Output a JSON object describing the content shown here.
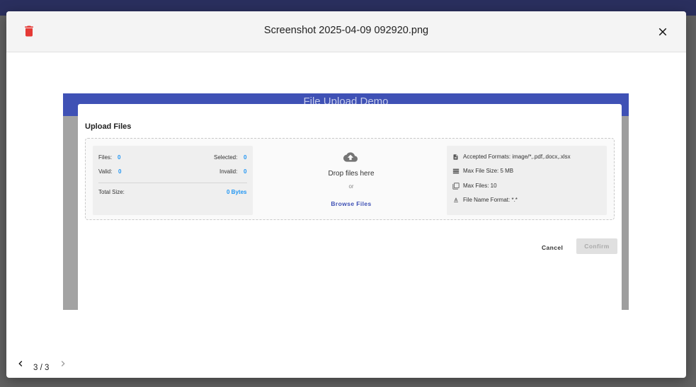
{
  "colors": {
    "trash": "#e53935",
    "accent": "#2196f3",
    "appbar": "#3f51b5"
  },
  "viewer": {
    "title": "Screenshot 2025-04-09 092920.png",
    "page_indicator": "3 / 3",
    "icons": {
      "delete": "trash-icon",
      "close": "close-icon",
      "prev": "chevron-left-icon",
      "next": "chevron-right-icon"
    }
  },
  "preview": {
    "app_title": "File Upload Demo",
    "dialog_title": "Upload Files",
    "stats": {
      "files_label": "Files:",
      "files_value": "0",
      "selected_label": "Selected:",
      "selected_value": "0",
      "valid_label": "Valid:",
      "valid_value": "0",
      "invalid_label": "Invalid:",
      "invalid_value": "0",
      "total_size_label": "Total Size:",
      "total_size_value": "0 Bytes"
    },
    "dropzone": {
      "drop_text": "Drop files here",
      "or_text": "or",
      "browse_label": "Browse Files",
      "icon": "cloud-upload-icon"
    },
    "rules": {
      "accepted_formats": "Accepted Formats: image/*,.pdf,.docx,.xlsx",
      "max_file_size": "Max File Size: 5 MB",
      "max_files": "Max Files: 10",
      "file_name_format": "File Name Format: *.*"
    },
    "actions": {
      "cancel_label": "Cancel",
      "confirm_label": "Confirm"
    }
  }
}
